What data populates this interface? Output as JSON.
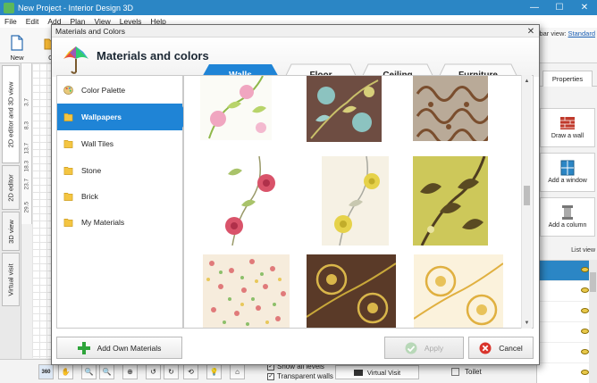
{
  "app": {
    "title": "New Project - Interior Design 3D",
    "menu": [
      "File",
      "Edit",
      "Add",
      "Plan",
      "View",
      "Levels",
      "Help"
    ],
    "toolbar": {
      "new_label": "New",
      "open_label": "O",
      "view_label": "bar view:",
      "view_value": "Standard"
    },
    "side_tabs": [
      "2D editor and 3D view",
      "2D editor",
      "3D view",
      "Virtual visit"
    ],
    "ruler_values": [
      "3.7",
      "8.3",
      "13.7",
      "18.3",
      "23.7",
      "29.5"
    ],
    "right_panel": {
      "tab": "Properties",
      "tools": [
        "Draw a wall",
        "Add a window",
        "Add a column"
      ],
      "list_view": "List view"
    },
    "bottom": {
      "checks": [
        "Show all levels",
        "Transparent walls"
      ],
      "virtual_visit": "Virtual Visit",
      "list_item": "Toilet",
      "view_360": "360"
    }
  },
  "dialog": {
    "title": "Materials and Colors",
    "heading": "Materials and colors",
    "tabs": [
      "Walls",
      "Floor",
      "Ceiling",
      "Furniture"
    ],
    "active_tab": "Walls",
    "categories": [
      "Color Palette",
      "Wallpapers",
      "Wall Tiles",
      "Stone",
      "Brick",
      "My Materials"
    ],
    "active_category": "Wallpapers",
    "buttons": {
      "add": "Add Own Materials",
      "apply": "Apply",
      "cancel": "Cancel"
    }
  },
  "colors": {
    "accent": "#1f84d6",
    "titlebar": "#2b86c5"
  }
}
